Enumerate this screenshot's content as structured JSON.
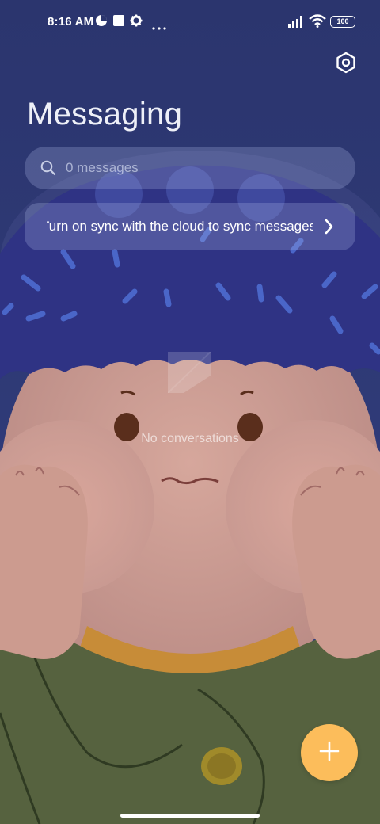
{
  "status_bar": {
    "time": "8:16 AM",
    "battery": "100",
    "icons": [
      "timer-icon",
      "notification-square-icon",
      "gear-icon",
      "more-dots-icon",
      "signal-icon",
      "wifi-icon",
      "battery-icon"
    ]
  },
  "header": {
    "title": "Messaging",
    "settings_icon": "settings-hexagon-icon"
  },
  "search": {
    "placeholder": "0 messages"
  },
  "sync_banner": {
    "text": "Turn on sync with the cloud to sync messages"
  },
  "empty_state": {
    "text": "No conversations"
  },
  "fab": {
    "icon": "plus-icon",
    "color": "#fcbd5b"
  },
  "colors": {
    "background_top": "#2c3670",
    "accent": "#fcbd5b"
  }
}
